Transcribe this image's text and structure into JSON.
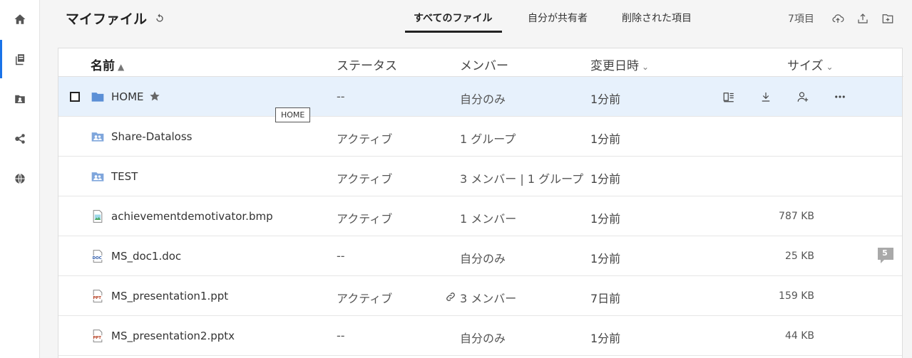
{
  "header": {
    "title": "マイファイル",
    "tabs": [
      {
        "label": "すべてのファイル",
        "active": true
      },
      {
        "label": "自分が共有者",
        "active": false
      },
      {
        "label": "削除された項目",
        "active": false
      }
    ],
    "item_count": "7項目"
  },
  "nav": {
    "items": [
      {
        "icon": "home-icon"
      },
      {
        "icon": "files-icon",
        "active": true
      },
      {
        "icon": "shared-folder-icon"
      },
      {
        "icon": "network-icon"
      },
      {
        "icon": "globe-icon"
      }
    ]
  },
  "table": {
    "columns": {
      "name": "名前",
      "status": "ステータス",
      "member": "メンバー",
      "modified": "変更日時",
      "size": "サイズ"
    },
    "rows": [
      {
        "name": "HOME",
        "type": "folder",
        "status": "--",
        "member": "自分のみ",
        "modified": "1分前",
        "size": ""
      },
      {
        "name": "Share-Dataloss",
        "type": "shared-folder",
        "status": "アクティブ",
        "member": "1 グループ",
        "modified": "1分前",
        "size": ""
      },
      {
        "name": "TEST",
        "type": "shared-folder",
        "status": "アクティブ",
        "member": "3 メンバー | 1 グループ",
        "modified": "1分前",
        "size": ""
      },
      {
        "name": "achievementdemotivator.bmp",
        "type": "image",
        "status": "アクティブ",
        "member": "1 メンバー",
        "modified": "1分前",
        "size": "787 KB"
      },
      {
        "name": "MS_doc1.doc",
        "type": "doc",
        "status": "--",
        "member": "自分のみ",
        "modified": "1分前",
        "size": "25 KB",
        "comments": "5"
      },
      {
        "name": "MS_presentation1.ppt",
        "type": "ppt",
        "status": "アクティブ",
        "member": "3 メンバー",
        "modified": "7日前",
        "size": "159 KB"
      },
      {
        "name": "MS_presentation2.pptx",
        "type": "ppt",
        "status": "--",
        "member": "自分のみ",
        "modified": "1分前",
        "size": "44 KB"
      }
    ]
  },
  "tooltip": "HOME",
  "colors": {
    "accent": "#1a73e8",
    "selected_row": "#e7f1fc",
    "folder": "#5b8fd6"
  }
}
